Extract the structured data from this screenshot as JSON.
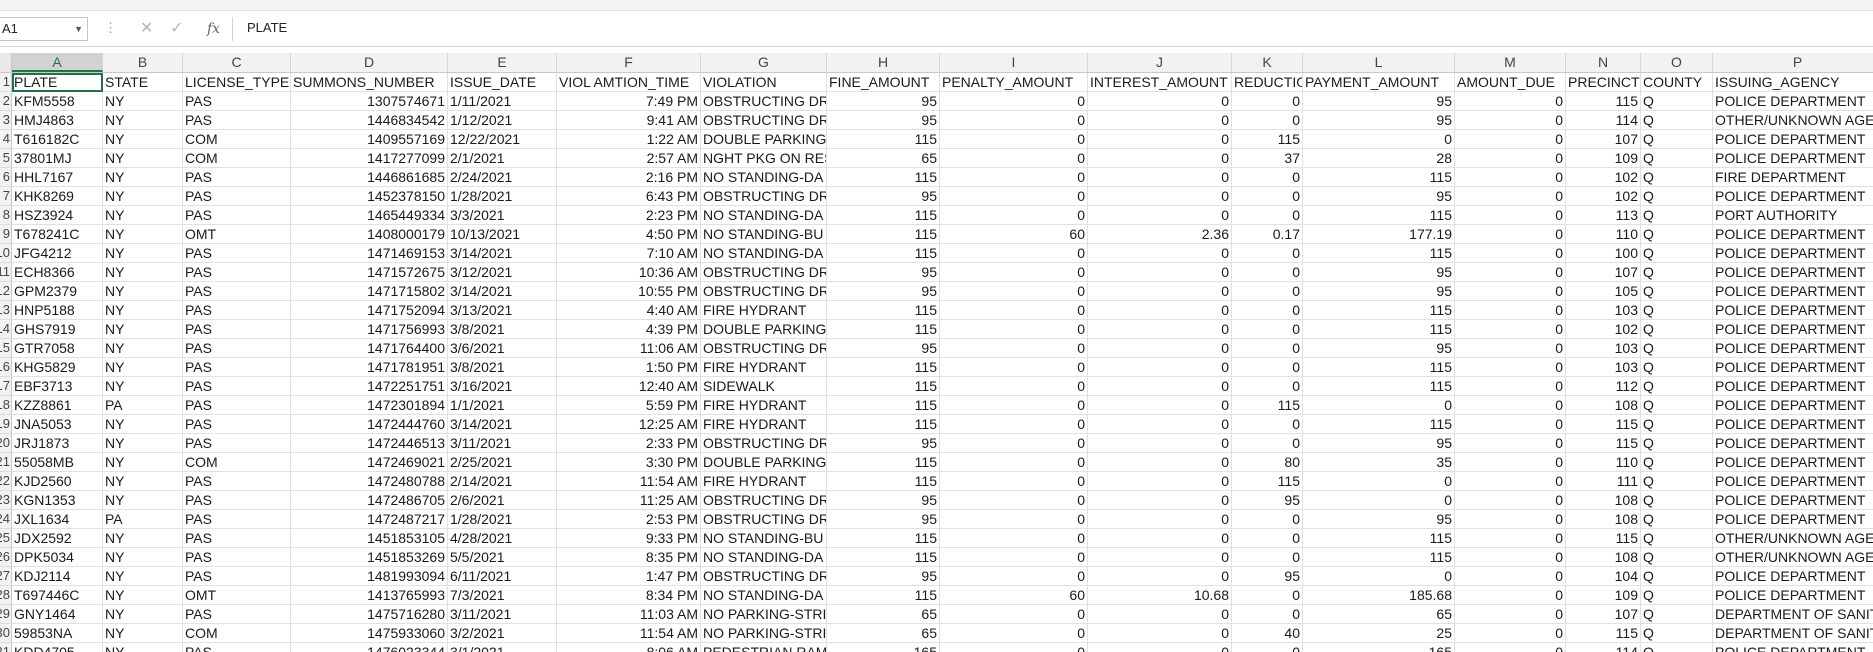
{
  "formula_bar": {
    "name_box": "A1",
    "content": "PLATE",
    "fx_label": "fx",
    "cancel_symbol": "✕",
    "enter_symbol": "✓",
    "more_symbol": "⋮"
  },
  "sheet": {
    "selected_cell": "A1",
    "column_letters": [
      "A",
      "B",
      "C",
      "D",
      "E",
      "F",
      "G",
      "H",
      "I",
      "J",
      "K",
      "L",
      "M",
      "N",
      "O",
      "P"
    ],
    "headers": [
      "PLATE",
      "STATE",
      "LICENSE_TYPE",
      "SUMMONS_NUMBER",
      "ISSUE_DATE",
      "VIOL AMTION_TIME",
      "VIOLATION",
      "FINE_AMOUNT",
      "PENALTY_AMOUNT",
      "INTEREST_AMOUNT",
      "REDUCTIO",
      "PAYMENT_AMOUNT",
      "AMOUNT_DUE",
      "PRECINCT",
      "COUNTY",
      "ISSUING_AGENCY"
    ],
    "row_numbers": [
      "1",
      "2",
      "3",
      "4",
      "5",
      "6",
      "7",
      "8",
      "9",
      "10",
      "11",
      "12",
      "13",
      "14",
      "15",
      "16",
      "17",
      "18",
      "19",
      "20",
      "21",
      "22",
      "23",
      "24",
      "25",
      "26",
      "27",
      "28",
      "29",
      "30",
      "31"
    ],
    "rows": [
      [
        "KFM5558",
        "NY",
        "PAS",
        "1307574671",
        "1/11/2021",
        "7:49 PM",
        "OBSTRUCTING DRI",
        "95",
        "0",
        "0",
        "0",
        "95",
        "0",
        "115",
        "Q",
        "POLICE DEPARTMENT"
      ],
      [
        "HMJ4863",
        "NY",
        "PAS",
        "1446834542",
        "1/12/2021",
        "9:41 AM",
        "OBSTRUCTING DRI",
        "95",
        "0",
        "0",
        "0",
        "95",
        "0",
        "114",
        "Q",
        "OTHER/UNKNOWN AGE"
      ],
      [
        "T616182C",
        "NY",
        "COM",
        "1409557169",
        "12/22/2021",
        "1:22 AM",
        "DOUBLE PARKING",
        "115",
        "0",
        "0",
        "115",
        "0",
        "0",
        "107",
        "Q",
        "POLICE DEPARTMENT"
      ],
      [
        "37801MJ",
        "NY",
        "COM",
        "1417277099",
        "2/1/2021",
        "2:57 AM",
        "NGHT PKG ON RES",
        "65",
        "0",
        "0",
        "37",
        "28",
        "0",
        "109",
        "Q",
        "POLICE DEPARTMENT"
      ],
      [
        "HHL7167",
        "NY",
        "PAS",
        "1446861685",
        "2/24/2021",
        "2:16 PM",
        "NO STANDING-DA",
        "115",
        "0",
        "0",
        "0",
        "115",
        "0",
        "102",
        "Q",
        "FIRE DEPARTMENT"
      ],
      [
        "KHK8269",
        "NY",
        "PAS",
        "1452378150",
        "1/28/2021",
        "6:43 PM",
        "OBSTRUCTING DRI",
        "95",
        "0",
        "0",
        "0",
        "95",
        "0",
        "102",
        "Q",
        "POLICE DEPARTMENT"
      ],
      [
        "HSZ3924",
        "NY",
        "PAS",
        "1465449334",
        "3/3/2021",
        "2:23 PM",
        "NO STANDING-DA",
        "115",
        "0",
        "0",
        "0",
        "115",
        "0",
        "113",
        "Q",
        "PORT AUTHORITY"
      ],
      [
        "T678241C",
        "NY",
        "OMT",
        "1408000179",
        "10/13/2021",
        "4:50 PM",
        "NO STANDING-BU",
        "115",
        "60",
        "2.36",
        "0.17",
        "177.19",
        "0",
        "110",
        "Q",
        "POLICE DEPARTMENT"
      ],
      [
        "JFG4212",
        "NY",
        "PAS",
        "1471469153",
        "3/14/2021",
        "7:10 AM",
        "NO STANDING-DA",
        "115",
        "0",
        "0",
        "0",
        "115",
        "0",
        "100",
        "Q",
        "POLICE DEPARTMENT"
      ],
      [
        "ECH8366",
        "NY",
        "PAS",
        "1471572675",
        "3/12/2021",
        "10:36 AM",
        "OBSTRUCTING DRI",
        "95",
        "0",
        "0",
        "0",
        "95",
        "0",
        "107",
        "Q",
        "POLICE DEPARTMENT"
      ],
      [
        "GPM2379",
        "NY",
        "PAS",
        "1471715802",
        "3/14/2021",
        "10:55 PM",
        "OBSTRUCTING DRI",
        "95",
        "0",
        "0",
        "0",
        "95",
        "0",
        "105",
        "Q",
        "POLICE DEPARTMENT"
      ],
      [
        "HNP5188",
        "NY",
        "PAS",
        "1471752094",
        "3/13/2021",
        "4:40 AM",
        "FIRE HYDRANT",
        "115",
        "0",
        "0",
        "0",
        "115",
        "0",
        "103",
        "Q",
        "POLICE DEPARTMENT"
      ],
      [
        "GHS7919",
        "NY",
        "PAS",
        "1471756993",
        "3/8/2021",
        "4:39 PM",
        "DOUBLE PARKING",
        "115",
        "0",
        "0",
        "0",
        "115",
        "0",
        "102",
        "Q",
        "POLICE DEPARTMENT"
      ],
      [
        "GTR7058",
        "NY",
        "PAS",
        "1471764400",
        "3/6/2021",
        "11:06 AM",
        "OBSTRUCTING DRI",
        "95",
        "0",
        "0",
        "0",
        "95",
        "0",
        "103",
        "Q",
        "POLICE DEPARTMENT"
      ],
      [
        "KHG5829",
        "NY",
        "PAS",
        "1471781951",
        "3/8/2021",
        "1:50 PM",
        "FIRE HYDRANT",
        "115",
        "0",
        "0",
        "0",
        "115",
        "0",
        "103",
        "Q",
        "POLICE DEPARTMENT"
      ],
      [
        "EBF3713",
        "NY",
        "PAS",
        "1472251751",
        "3/16/2021",
        "12:40 AM",
        "SIDEWALK",
        "115",
        "0",
        "0",
        "0",
        "115",
        "0",
        "112",
        "Q",
        "POLICE DEPARTMENT"
      ],
      [
        "KZZ8861",
        "PA",
        "PAS",
        "1472301894",
        "1/1/2021",
        "5:59 PM",
        "FIRE HYDRANT",
        "115",
        "0",
        "0",
        "115",
        "0",
        "0",
        "108",
        "Q",
        "POLICE DEPARTMENT"
      ],
      [
        "JNA5053",
        "NY",
        "PAS",
        "1472444760",
        "3/14/2021",
        "12:25 AM",
        "FIRE HYDRANT",
        "115",
        "0",
        "0",
        "0",
        "115",
        "0",
        "115",
        "Q",
        "POLICE DEPARTMENT"
      ],
      [
        "JRJ1873",
        "NY",
        "PAS",
        "1472446513",
        "3/11/2021",
        "2:33 PM",
        "OBSTRUCTING DRI",
        "95",
        "0",
        "0",
        "0",
        "95",
        "0",
        "115",
        "Q",
        "POLICE DEPARTMENT"
      ],
      [
        "55058MB",
        "NY",
        "COM",
        "1472469021",
        "2/25/2021",
        "3:30 PM",
        "DOUBLE PARKING",
        "115",
        "0",
        "0",
        "80",
        "35",
        "0",
        "110",
        "Q",
        "POLICE DEPARTMENT"
      ],
      [
        "KJD2560",
        "NY",
        "PAS",
        "1472480788",
        "2/14/2021",
        "11:54 AM",
        "FIRE HYDRANT",
        "115",
        "0",
        "0",
        "115",
        "0",
        "0",
        "111",
        "Q",
        "POLICE DEPARTMENT"
      ],
      [
        "KGN1353",
        "NY",
        "PAS",
        "1472486705",
        "2/6/2021",
        "11:25 AM",
        "OBSTRUCTING DRI",
        "95",
        "0",
        "0",
        "95",
        "0",
        "0",
        "108",
        "Q",
        "POLICE DEPARTMENT"
      ],
      [
        "JXL1634",
        "PA",
        "PAS",
        "1472487217",
        "1/28/2021",
        "2:53 PM",
        "OBSTRUCTING DRI",
        "95",
        "0",
        "0",
        "0",
        "95",
        "0",
        "108",
        "Q",
        "POLICE DEPARTMENT"
      ],
      [
        "JDX2592",
        "NY",
        "PAS",
        "1451853105",
        "4/28/2021",
        "9:33 PM",
        "NO STANDING-BU",
        "115",
        "0",
        "0",
        "0",
        "115",
        "0",
        "115",
        "Q",
        "OTHER/UNKNOWN AGE"
      ],
      [
        "DPK5034",
        "NY",
        "PAS",
        "1451853269",
        "5/5/2021",
        "8:35 PM",
        "NO STANDING-DA",
        "115",
        "0",
        "0",
        "0",
        "115",
        "0",
        "108",
        "Q",
        "OTHER/UNKNOWN AGE"
      ],
      [
        "KDJ2114",
        "NY",
        "PAS",
        "1481993094",
        "6/11/2021",
        "1:47 PM",
        "OBSTRUCTING DRI",
        "95",
        "0",
        "0",
        "95",
        "0",
        "0",
        "104",
        "Q",
        "POLICE DEPARTMENT"
      ],
      [
        "T697446C",
        "NY",
        "OMT",
        "1413765993",
        "7/3/2021",
        "8:34 PM",
        "NO STANDING-DA",
        "115",
        "60",
        "10.68",
        "0",
        "185.68",
        "0",
        "109",
        "Q",
        "POLICE DEPARTMENT"
      ],
      [
        "GNY1464",
        "NY",
        "PAS",
        "1475716280",
        "3/11/2021",
        "11:03 AM",
        "NO PARKING-STRI",
        "65",
        "0",
        "0",
        "0",
        "65",
        "0",
        "107",
        "Q",
        "DEPARTMENT OF SANIT"
      ],
      [
        "59853NA",
        "NY",
        "COM",
        "1475933060",
        "3/2/2021",
        "11:54 AM",
        "NO PARKING-STRI",
        "65",
        "0",
        "0",
        "40",
        "25",
        "0",
        "115",
        "Q",
        "DEPARTMENT OF SANIT"
      ],
      [
        "KDD4705",
        "NY",
        "PAS",
        "1476023344",
        "3/1/2021",
        "8:06 AM",
        "PEDESTRIAN RAMI",
        "165",
        "0",
        "0",
        "0",
        "165",
        "0",
        "114",
        "Q",
        "POLICE DEPARTMENT"
      ]
    ]
  },
  "colors": {
    "accent": "#217346",
    "grid": "#e1e1e1",
    "header_bg": "#f2f2f2"
  }
}
